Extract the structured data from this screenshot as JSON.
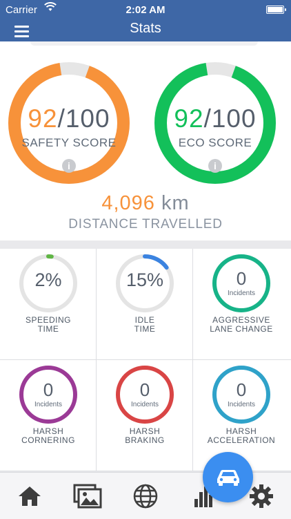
{
  "status_bar": {
    "carrier": "Carrier",
    "time": "2:02 AM"
  },
  "nav": {
    "title": "Stats",
    "menu_icon": "hamburger-menu-icon"
  },
  "safety": {
    "value": "92",
    "max": "/100",
    "label": "SAFETY SCORE",
    "fraction": 0.92,
    "color": "#f7923a"
  },
  "eco": {
    "value": "92",
    "max": "/100",
    "label": "ECO SCORE",
    "fraction": 0.92,
    "color": "#13c05a"
  },
  "info_glyph": "i",
  "distance": {
    "value": "4,096",
    "unit": " km",
    "label": "DISTANCE TRAVELLED"
  },
  "metrics": [
    {
      "value": "2%",
      "label_line1": "SPEEDING",
      "label_line2": "TIME",
      "fraction": 0.02,
      "color": "#5fb544"
    },
    {
      "value": "15%",
      "label_line1": "IDLE",
      "label_line2": "TIME",
      "fraction": 0.15,
      "color": "#3b83e0"
    },
    {
      "value": "0",
      "sub": "Incidents",
      "label_line1": "AGGRESSIVE",
      "label_line2": "LANE CHANGE",
      "color": "#17b388"
    },
    {
      "value": "0",
      "sub": "Incidents",
      "label_line1": "HARSH",
      "label_line2": "CORNERING",
      "color": "#9b3a96"
    },
    {
      "value": "0",
      "sub": "Incidents",
      "label_line1": "HARSH",
      "label_line2": "BRAKING",
      "color": "#d94545"
    },
    {
      "value": "0",
      "sub": "Incidents",
      "label_line1": "HARSH",
      "label_line2": "ACCELERATION",
      "color": "#2fa2c9"
    }
  ],
  "tabs": [
    "home-icon",
    "gallery-icon",
    "globe-icon",
    "stats-icon",
    "settings-icon"
  ],
  "fab_icon": "car-icon"
}
